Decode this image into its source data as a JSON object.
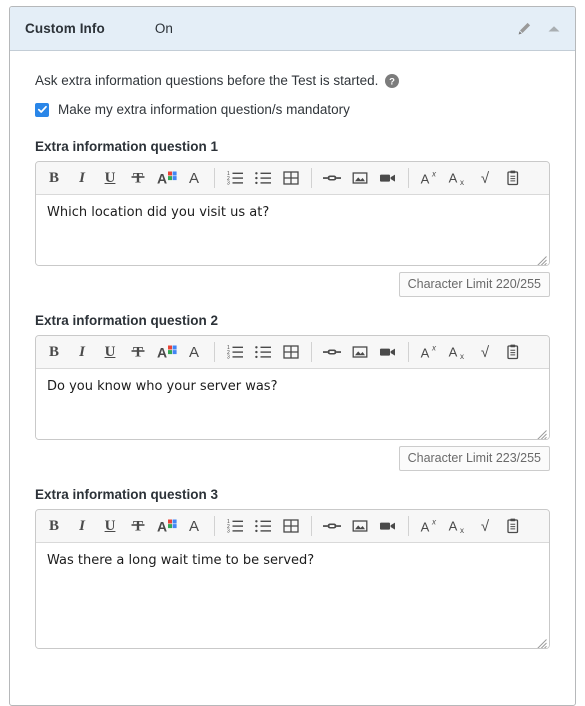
{
  "panel": {
    "title": "Custom Info",
    "state": "On",
    "edit_icon": "pencil-icon",
    "collapse_icon": "chevron-up-icon"
  },
  "body": {
    "description": "Ask extra information questions before the Test is started.",
    "help_icon": "help-circle-icon",
    "mandatory_checkbox": {
      "label": "Make my extra information question/s mandatory",
      "checked": true
    }
  },
  "toolbar": {
    "groups": [
      {
        "buttons": [
          {
            "name": "bold-icon",
            "glyph": "B",
            "style": "tb-b"
          },
          {
            "name": "italic-icon",
            "glyph": "I",
            "style": "tb-i"
          },
          {
            "name": "underline-icon",
            "glyph": "U",
            "style": "tb-u"
          },
          {
            "name": "strikethrough-icon",
            "glyph": "",
            "style": "svg-strike"
          },
          {
            "name": "text-color-icon",
            "glyph": "",
            "style": "svg-textcolor"
          },
          {
            "name": "font-family-icon",
            "glyph": "A",
            "style": "tb-plain"
          }
        ]
      },
      {
        "buttons": [
          {
            "name": "ordered-list-icon",
            "glyph": "",
            "style": "svg-ol"
          },
          {
            "name": "unordered-list-icon",
            "glyph": "",
            "style": "svg-ul"
          },
          {
            "name": "table-icon",
            "glyph": "",
            "style": "svg-table"
          }
        ]
      },
      {
        "buttons": [
          {
            "name": "link-icon",
            "glyph": "",
            "style": "svg-link"
          },
          {
            "name": "image-icon",
            "glyph": "",
            "style": "svg-image"
          },
          {
            "name": "video-icon",
            "glyph": "",
            "style": "svg-video"
          }
        ]
      },
      {
        "buttons": [
          {
            "name": "superscript-icon",
            "glyph": "",
            "style": "svg-sup"
          },
          {
            "name": "subscript-icon",
            "glyph": "",
            "style": "svg-sub"
          },
          {
            "name": "square-root-icon",
            "glyph": "√",
            "style": "tb-plain"
          },
          {
            "name": "paste-clipboard-icon",
            "glyph": "",
            "style": "svg-clip"
          }
        ]
      }
    ]
  },
  "questions": [
    {
      "label": "Extra information question 1",
      "value": "Which location did you visit us at?",
      "placeholder": "",
      "char_limit": "Character Limit 220/255"
    },
    {
      "label": "Extra information question 2",
      "value": "Do you know who your server was?",
      "placeholder": "",
      "char_limit": "Character Limit 223/255"
    },
    {
      "label": "Extra information question 3",
      "value": "Was there a long wait time to be served?",
      "placeholder": "",
      "char_limit": ""
    }
  ],
  "colors": {
    "header_bg": "#e4eef7",
    "card_border": "#b6b8ba",
    "accent": "#2a86e8",
    "toolbar_bg": "#f7f7f7",
    "text": "#2c3238"
  }
}
